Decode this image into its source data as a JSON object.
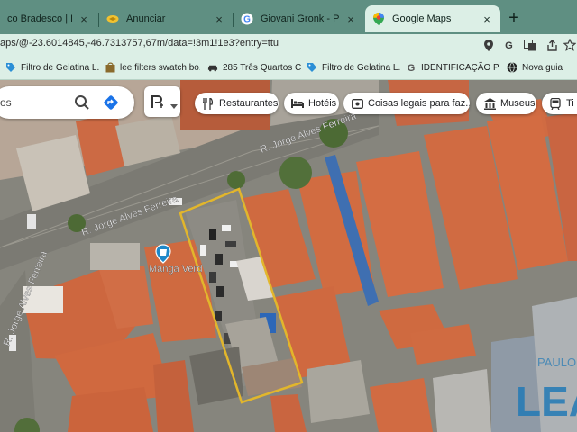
{
  "tabs": [
    {
      "label": "co Bradesco | Entre N",
      "icon": "bradesco-icon",
      "active": false
    },
    {
      "label": "Anunciar",
      "icon": "handshake-icon",
      "active": false
    },
    {
      "label": "Giovani Gronk - Pesquisa",
      "icon": "google-icon",
      "active": false
    },
    {
      "label": "Google Maps",
      "icon": "maps-icon",
      "active": true
    }
  ],
  "close_glyph": "×",
  "new_tab_glyph": "+",
  "address": {
    "url": "aps/@-23.6014845,-46.7313757,67m/data=!3m1!1e3?entry=ttu"
  },
  "bookmarks": [
    {
      "label": "Filtro de Gelatina L...",
      "icon": "tag-icon"
    },
    {
      "label": "lee filters swatch bo...",
      "icon": "bag-icon"
    },
    {
      "label": "285 Três Quartos C...",
      "icon": "car-icon"
    },
    {
      "label": "Filtro de Gelatina L...",
      "icon": "tag-icon"
    },
    {
      "label": "IDENTIFICAÇÃO PA...",
      "icon": "google-icon"
    },
    {
      "label": "Nova guia",
      "icon": "globe-icon"
    }
  ],
  "search": {
    "text": "os"
  },
  "chips": [
    {
      "label": "Restaurantes",
      "icon": "fork-knife-icon"
    },
    {
      "label": "Hotéis",
      "icon": "bed-icon"
    },
    {
      "label": "Coisas legais para faz...",
      "icon": "ticket-icon"
    },
    {
      "label": "Museus",
      "icon": "museum-icon"
    },
    {
      "label": "Ti",
      "icon": "transit-icon"
    }
  ],
  "map": {
    "street_labels": [
      "R. Jorge Alves Ferreira",
      "R. Jorge Alves Ferreira",
      "R. Jorge Alves Ferreira"
    ],
    "place_label": "Manga Verd",
    "watermark": "LEA",
    "watermark_small": "PAULO"
  },
  "colors": {
    "tab_bar": "#5f8f82",
    "toolbar": "#dcefe6",
    "roof": "#d1683f",
    "road": "#7d7a72",
    "highlight": "#e2b62c",
    "watermark": "#2279b5"
  }
}
